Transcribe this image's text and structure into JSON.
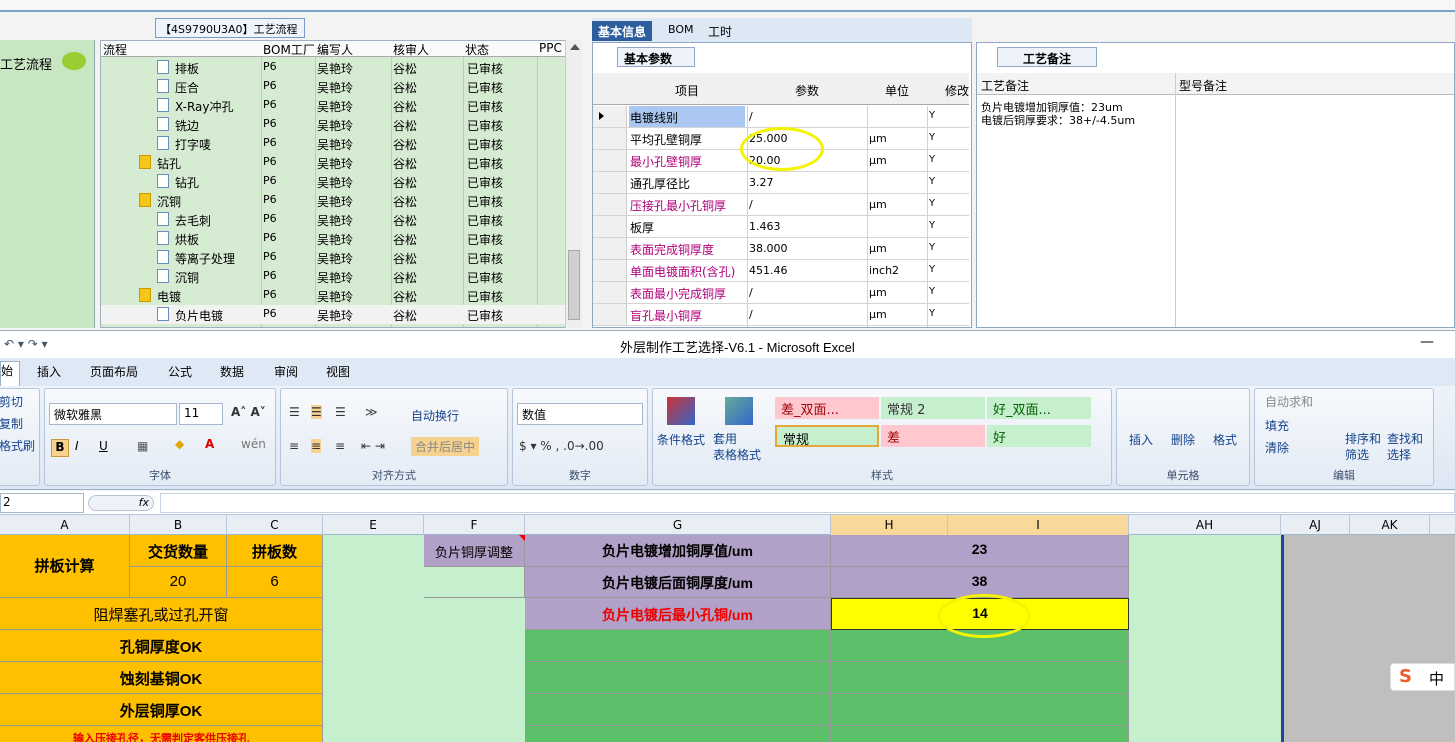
{
  "top_window": {
    "tree_title": "【4S9790U3A0】工艺流程",
    "left_tree_label": "工艺流程",
    "grid_headers": [
      "流程",
      "BOM工厂",
      "编写人",
      "核审人",
      "状态",
      "PPC"
    ],
    "rows": [
      {
        "name": "排板",
        "factory": "P6",
        "author": "吴艳玲",
        "reviewer": "谷松",
        "status": "已审核",
        "level": 2
      },
      {
        "name": "压合",
        "factory": "P6",
        "author": "吴艳玲",
        "reviewer": "谷松",
        "status": "已审核",
        "level": 2
      },
      {
        "name": "X-Ray冲孔",
        "factory": "P6",
        "author": "吴艳玲",
        "reviewer": "谷松",
        "status": "已审核",
        "level": 2
      },
      {
        "name": "铣边",
        "factory": "P6",
        "author": "吴艳玲",
        "reviewer": "谷松",
        "status": "已审核",
        "level": 2
      },
      {
        "name": "打字唛",
        "factory": "P6",
        "author": "吴艳玲",
        "reviewer": "谷松",
        "status": "已审核",
        "level": 2
      },
      {
        "name": "钻孔",
        "factory": "P6",
        "author": "吴艳玲",
        "reviewer": "谷松",
        "status": "已审核",
        "level": 1
      },
      {
        "name": "钻孔",
        "factory": "P6",
        "author": "吴艳玲",
        "reviewer": "谷松",
        "status": "已审核",
        "level": 2
      },
      {
        "name": "沉铜",
        "factory": "P6",
        "author": "吴艳玲",
        "reviewer": "谷松",
        "status": "已审核",
        "level": 1
      },
      {
        "name": "去毛刺",
        "factory": "P6",
        "author": "吴艳玲",
        "reviewer": "谷松",
        "status": "已审核",
        "level": 2
      },
      {
        "name": "烘板",
        "factory": "P6",
        "author": "吴艳玲",
        "reviewer": "谷松",
        "status": "已审核",
        "level": 2
      },
      {
        "name": "等离子处理",
        "factory": "P6",
        "author": "吴艳玲",
        "reviewer": "谷松",
        "status": "已审核",
        "level": 2
      },
      {
        "name": "沉铜",
        "factory": "P6",
        "author": "吴艳玲",
        "reviewer": "谷松",
        "status": "已审核",
        "level": 2
      },
      {
        "name": "电镀",
        "factory": "P6",
        "author": "吴艳玲",
        "reviewer": "谷松",
        "status": "已审核",
        "level": 1
      },
      {
        "name": "负片电镀",
        "factory": "P6",
        "author": "吴艳玲",
        "reviewer": "谷松",
        "status": "已审核",
        "level": 2
      }
    ],
    "right_tabs": [
      "基本信息",
      "BOM",
      "工时"
    ],
    "basic_params_tab": "基本参数",
    "param_headers": [
      "项目",
      "参数",
      "单位",
      "修改"
    ],
    "params": [
      {
        "item": "电镀线别",
        "value": "/",
        "unit": "",
        "flag": "Y",
        "red": false
      },
      {
        "item": "平均孔壁铜厚",
        "value": "25.000",
        "unit": "μm",
        "flag": "Y",
        "red": false
      },
      {
        "item": "最小孔壁铜厚",
        "value": "20.00",
        "unit": "μm",
        "flag": "Y",
        "red": true
      },
      {
        "item": "通孔厚径比",
        "value": "3.27",
        "unit": "",
        "flag": "Y",
        "red": false
      },
      {
        "item": "压接孔最小孔铜厚",
        "value": "/",
        "unit": "μm",
        "flag": "Y",
        "red": true
      },
      {
        "item": "板厚",
        "value": "1.463",
        "unit": "",
        "flag": "Y",
        "red": false
      },
      {
        "item": "表面完成铜厚度",
        "value": "38.000",
        "unit": "μm",
        "flag": "Y",
        "red": true
      },
      {
        "item": "单面电镀面积(含孔)",
        "value": "451.46",
        "unit": "inch2",
        "flag": "Y",
        "red": true
      },
      {
        "item": "表面最小完成铜厚",
        "value": "/",
        "unit": "μm",
        "flag": "Y",
        "red": true
      },
      {
        "item": "盲孔最小铜厚",
        "value": "/",
        "unit": "μm",
        "flag": "Y",
        "red": true
      }
    ],
    "memo_tab": "工艺备注",
    "memo_headers": [
      "工艺备注",
      "型号备注"
    ],
    "memo_lines": [
      "负片电镀增加铜厚值：23um",
      "电镀后铜厚要求：38+/-4.5um"
    ]
  },
  "excel": {
    "title": "外层制作工艺选择-V6.1 - Microsoft Excel",
    "tabs": [
      "始",
      "插入",
      "页面布局",
      "公式",
      "数据",
      "审阅",
      "视图"
    ],
    "clipboard": [
      "剪切",
      "复制",
      "格式刷"
    ],
    "font_name": "微软雅黑",
    "font_size": "11",
    "font_group": "字体",
    "align_group": "对齐方式",
    "number_group": "数字",
    "styles_group": "样式",
    "cells_group": "单元格",
    "edit_group": "编辑",
    "wrap_text": "自动换行",
    "merge_center": "合并后居中",
    "number_format": "数值",
    "cond_format": "条件格式",
    "table_format": "套用\n表格格式",
    "styles": [
      "差_双面...",
      "常规 2",
      "好_双面...",
      "常规",
      "差",
      "好"
    ],
    "cell_buttons": [
      "插入",
      "删除",
      "格式"
    ],
    "edit_buttons": [
      "自动求和",
      "填充",
      "清除",
      "排序和\n筛选",
      "查找和\n选择"
    ],
    "name_box": "2",
    "fx": "fx",
    "columns": [
      "A",
      "B",
      "C",
      "E",
      "F",
      "G",
      "H",
      "I",
      "AH",
      "AJ",
      "AK"
    ],
    "cells": {
      "panel_calc": "拼板计算",
      "delivery_qty_label": "交货数量",
      "panel_count_label": "拼板数",
      "delivery_qty": "20",
      "panel_count": "6",
      "solder_mask": "阻焊塞孔或过孔开窗",
      "hole_cu_ok": "孔铜厚度OK",
      "etch_base_ok": "蚀刻基铜OK",
      "outer_cu_ok": "外层铜厚OK",
      "press_fit_hint": "输入压接孔径，无需判定客供压接孔",
      "adjust_label": "负片铜厚调整",
      "add_cu_label": "负片电镀增加铜厚值/um",
      "add_cu_value": "23",
      "surface_cu_label": "负片电镀后面铜厚度/um",
      "surface_cu_value": "38",
      "min_hole_label": "负片电镀后最小孔铜/um",
      "min_hole_value": "14"
    },
    "ime_label": "中"
  }
}
